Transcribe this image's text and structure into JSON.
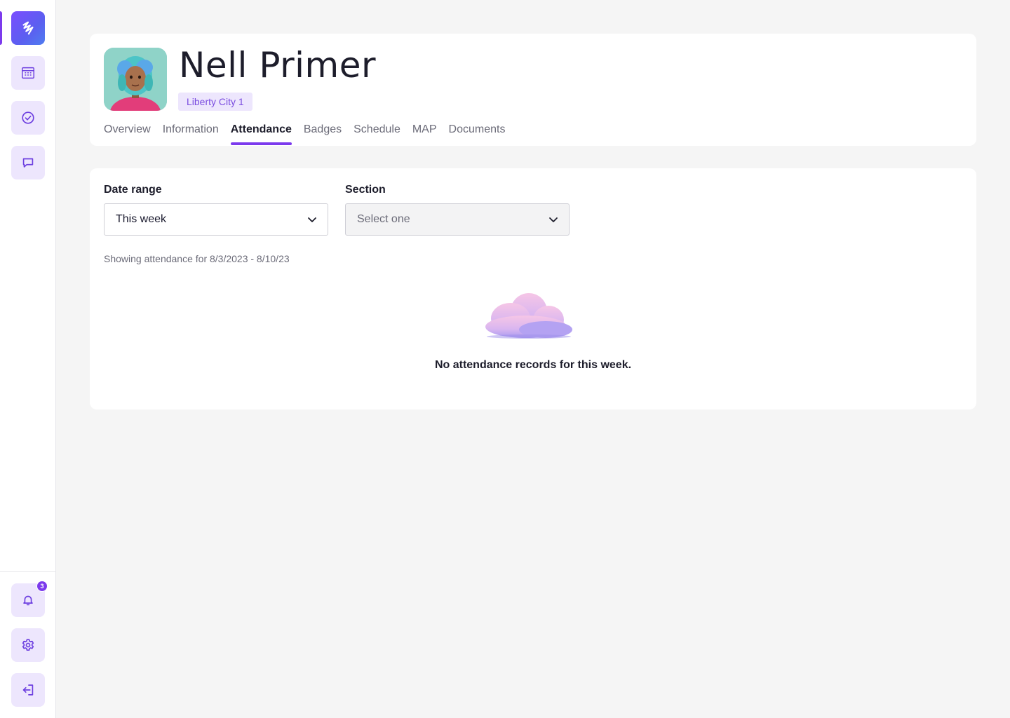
{
  "sidebar": {
    "top_items": [
      {
        "icon": "logo-icon"
      },
      {
        "icon": "calendar-icon"
      },
      {
        "icon": "check-circle-icon"
      },
      {
        "icon": "message-icon"
      }
    ],
    "bottom_items": [
      {
        "icon": "bell-icon",
        "badge": "3"
      },
      {
        "icon": "gear-icon"
      },
      {
        "icon": "logout-icon"
      }
    ]
  },
  "profile": {
    "name": "Nell Primer",
    "school": "Liberty City 1",
    "tabs": [
      {
        "label": "Overview",
        "active": false
      },
      {
        "label": "Information",
        "active": false
      },
      {
        "label": "Attendance",
        "active": true
      },
      {
        "label": "Badges",
        "active": false
      },
      {
        "label": "Schedule",
        "active": false
      },
      {
        "label": "MAP",
        "active": false
      },
      {
        "label": "Documents",
        "active": false
      }
    ]
  },
  "attendance": {
    "date_range": {
      "label": "Date range",
      "value": "This week"
    },
    "section": {
      "label": "Section",
      "placeholder": "Select one"
    },
    "range_note": "Showing attendance for 8/3/2023 - 8/10/23",
    "empty_message": "No attendance records for this week."
  },
  "colors": {
    "accent": "#7c3aed",
    "accent_soft": "#ede6fd",
    "background": "#f5f5f5"
  }
}
